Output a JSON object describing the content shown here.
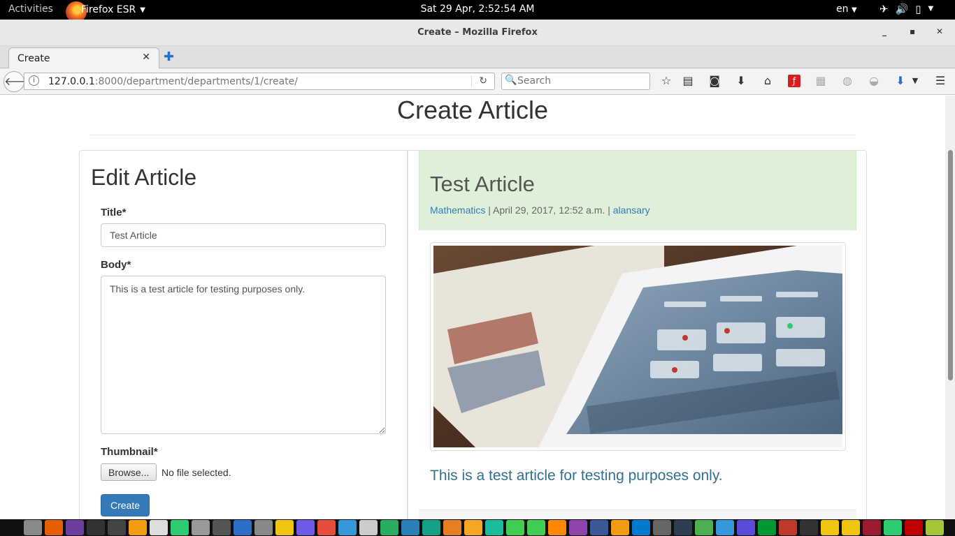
{
  "topbar": {
    "activities": "Activities",
    "app_name": "Firefox ESR",
    "clock": "Sat 29 Apr,  2:52:54 AM",
    "lang": "en"
  },
  "window": {
    "title": "Create – Mozilla Firefox"
  },
  "tab": {
    "label": "Create"
  },
  "urlbar": {
    "host": "127.0.0.1",
    "path": ":8000/department/departments/1/create/"
  },
  "search": {
    "placeholder": "Search"
  },
  "page": {
    "title": "Create Article",
    "form": {
      "heading": "Edit Article",
      "title_label": "Title*",
      "title_value": "Test Article",
      "body_label": "Body*",
      "body_value": "This is a test article for testing purposes only.",
      "thumbnail_label": "Thumbnail*",
      "browse_label": "Browse...",
      "no_file": "No file selected.",
      "submit_label": "Create"
    },
    "preview": {
      "title": "Test Article",
      "category": "Mathematics",
      "sep1": " | ",
      "date": "April 29, 2017, 12:52 a.m.",
      "sep2": " | ",
      "author": "alansary",
      "body": "This is a test article for testing purposes only."
    }
  },
  "colors": {
    "primary": "#337ab7",
    "jumbotron_bg": "#dff0d8",
    "lead_text": "#31708f"
  },
  "dock_icons": [
    "files-icon",
    "firefox-icon",
    "texmaker-icon",
    "terminal-icon",
    "terminal2-icon",
    "sublime-icon",
    "home-icon",
    "pycharm-icon",
    "box-icon",
    "canopy-icon",
    "r-icon",
    "rstudio-icon",
    "blocks-icon",
    "eclipse-icon",
    "mosaic-icon",
    "mysql-workbench-icon",
    "spreadsheet-icon",
    "libreoffice-icon",
    "text-icon",
    "translate-icon",
    "settings-icon",
    "puzzle-icon",
    "bug-icon",
    "qt-icon",
    "qt2-icon",
    "vlc-icon",
    "texstudio-icon",
    "mail-icon",
    "sublime2-icon",
    "vscode-icon",
    "tex-icon",
    "network-icon",
    "chrome-icon",
    "grid-icon",
    "firefox2-icon",
    "vim-icon",
    "maple-icon",
    "terminal3-icon",
    "sun-icon",
    "box2-icon",
    "mendeley-icon",
    "globe-icon",
    "filezilla-icon",
    "android-icon"
  ]
}
